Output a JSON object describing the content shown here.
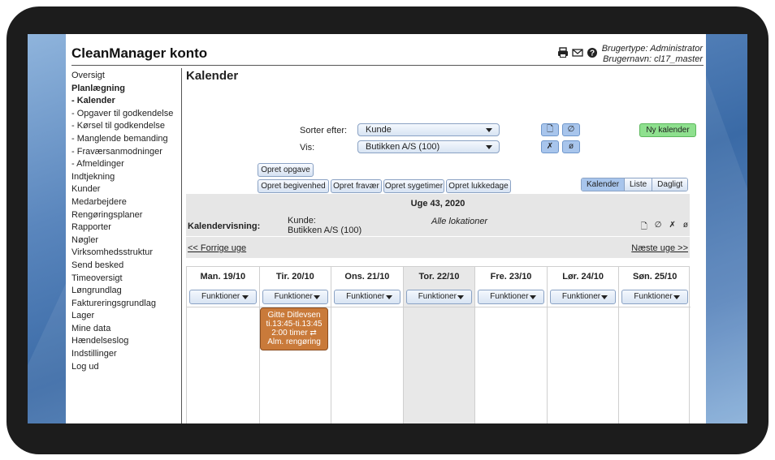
{
  "app": {
    "title": "CleanManager konto",
    "user_type": "Brugertype: Administrator",
    "user_name": "Brugernavn: cl17_master",
    "header_icons": [
      "printer-icon",
      "mail-icon",
      "help-icon"
    ]
  },
  "sidebar": {
    "items": [
      {
        "label": "Oversigt",
        "bold": false
      },
      {
        "label": "Planlægning",
        "bold": true
      },
      {
        "label": " - Kalender",
        "bold": true
      },
      {
        "label": " - Opgaver til godkendelse",
        "bold": false
      },
      {
        "label": " - Kørsel til godkendelse",
        "bold": false
      },
      {
        "label": " - Manglende bemanding",
        "bold": false
      },
      {
        "label": " - Fraværsanmodninger",
        "bold": false
      },
      {
        "label": " - Afmeldinger",
        "bold": false
      },
      {
        "label": "Indtjekning",
        "bold": false
      },
      {
        "label": "Kunder",
        "bold": false
      },
      {
        "label": "Medarbejdere",
        "bold": false
      },
      {
        "label": "Rengøringsplaner",
        "bold": false
      },
      {
        "label": "Rapporter",
        "bold": false
      },
      {
        "label": "Nøgler",
        "bold": false
      },
      {
        "label": "Virksomhedsstruktur",
        "bold": false
      },
      {
        "label": "Send besked",
        "bold": false
      },
      {
        "label": "Timeoversigt",
        "bold": false
      },
      {
        "label": "Løngrundlag",
        "bold": false
      },
      {
        "label": "Faktureringsgrundlag",
        "bold": false
      },
      {
        "label": "Lager",
        "bold": false
      },
      {
        "label": "Mine data",
        "bold": false
      },
      {
        "label": "Hændelseslog",
        "bold": false
      },
      {
        "label": "Indstillinger",
        "bold": false
      },
      {
        "label": "Log ud",
        "bold": false
      }
    ]
  },
  "main": {
    "title": "Kalender",
    "sort_label": "Sorter efter:",
    "sort_value": "Kunde",
    "view_label": "Vis:",
    "view_value": "Butikken A/S (100)",
    "new_calendar": "Ny kalender",
    "create_task": "Opret opgave",
    "create_buttons": [
      "Opret begivenhed",
      "Opret fravær",
      "Opret sygetimer",
      "Opret lukkedage"
    ],
    "view_modes": [
      "Kalender",
      "Liste",
      "Dagligt"
    ],
    "active_view": "Kalender",
    "week_label": "Uge 43, 2020",
    "calendar_view_label": "Kalendervisning:",
    "customer_label": "Kunde:",
    "customer_value": "Butikken A/S (100)",
    "location": "Alle lokationer",
    "prev_week": "<< Forrige uge",
    "next_week": "Næste uge >>",
    "functions_label": "Funktioner",
    "days": [
      "Man. 19/10",
      "Tir. 20/10",
      "Ons. 21/10",
      "Tor. 22/10",
      "Fre. 23/10",
      "Lør. 24/10",
      "Søn. 25/10"
    ],
    "today_index": 3,
    "event": {
      "name": "Gitte Ditlevsen",
      "time": "ti.13:45-ti.13:45",
      "duration": "2:00 timer ⇄",
      "type": "Alm. rengøring",
      "color": "#c97a3a"
    }
  }
}
